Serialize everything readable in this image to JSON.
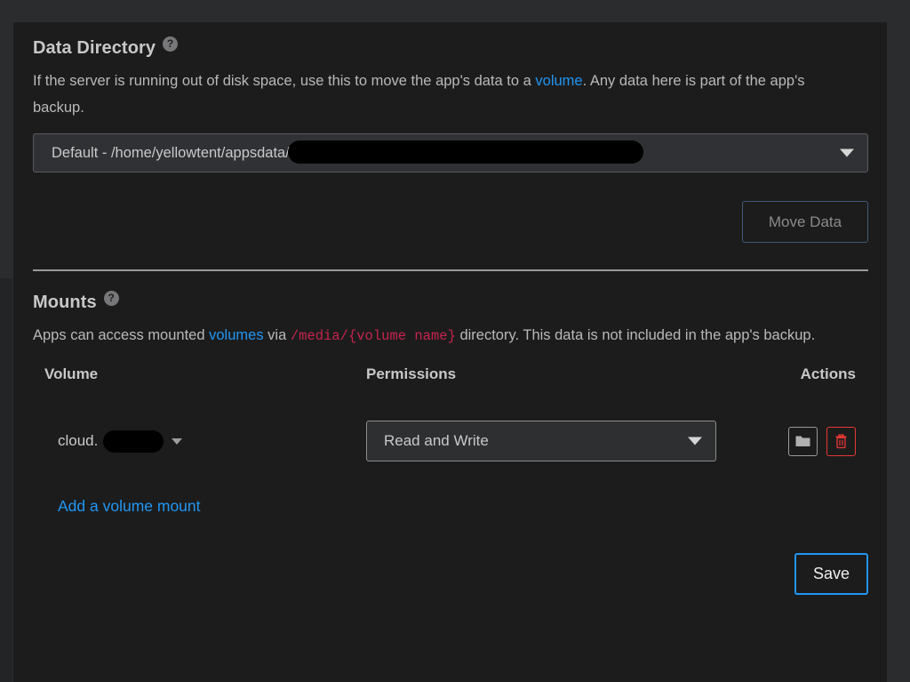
{
  "data_directory": {
    "title": "Data Directory",
    "help_icon": "question-mark-icon",
    "description_part1": "If the server is running out of disk space, use this to move the app's data to a ",
    "description_link": "volume",
    "description_part2": ". Any data here is part of the app's backup.",
    "select_value": "Default - /home/yellowtent/appsdata/",
    "select_redacted": true,
    "move_button_label": "Move Data",
    "move_button_enabled": false
  },
  "mounts": {
    "title": "Mounts",
    "help_icon": "question-mark-icon",
    "description_part1": "Apps can access mounted ",
    "description_link": "volumes",
    "description_part2": " via ",
    "description_code": "/media/{volume name}",
    "description_part3": " directory. This data is not included in the app's backup.",
    "table": {
      "headers": [
        "Volume",
        "Permissions",
        "Actions"
      ],
      "rows": [
        {
          "volume_label": "cloud.",
          "volume_redacted": true,
          "permissions": "Read and Write",
          "actions": [
            "folder-icon",
            "trash-icon"
          ]
        }
      ]
    },
    "add_link_label": "Add a volume mount"
  },
  "footer": {
    "save_label": "Save"
  },
  "colors": {
    "page_background": "#2b2c2e",
    "panel_background": "#1c1c1c",
    "link_blue": "#2196f3",
    "code_crimson": "#c7254e",
    "danger_red": "#e53935",
    "text_primary": "#c8c8c8",
    "text_secondary": "#b9b9b9"
  }
}
